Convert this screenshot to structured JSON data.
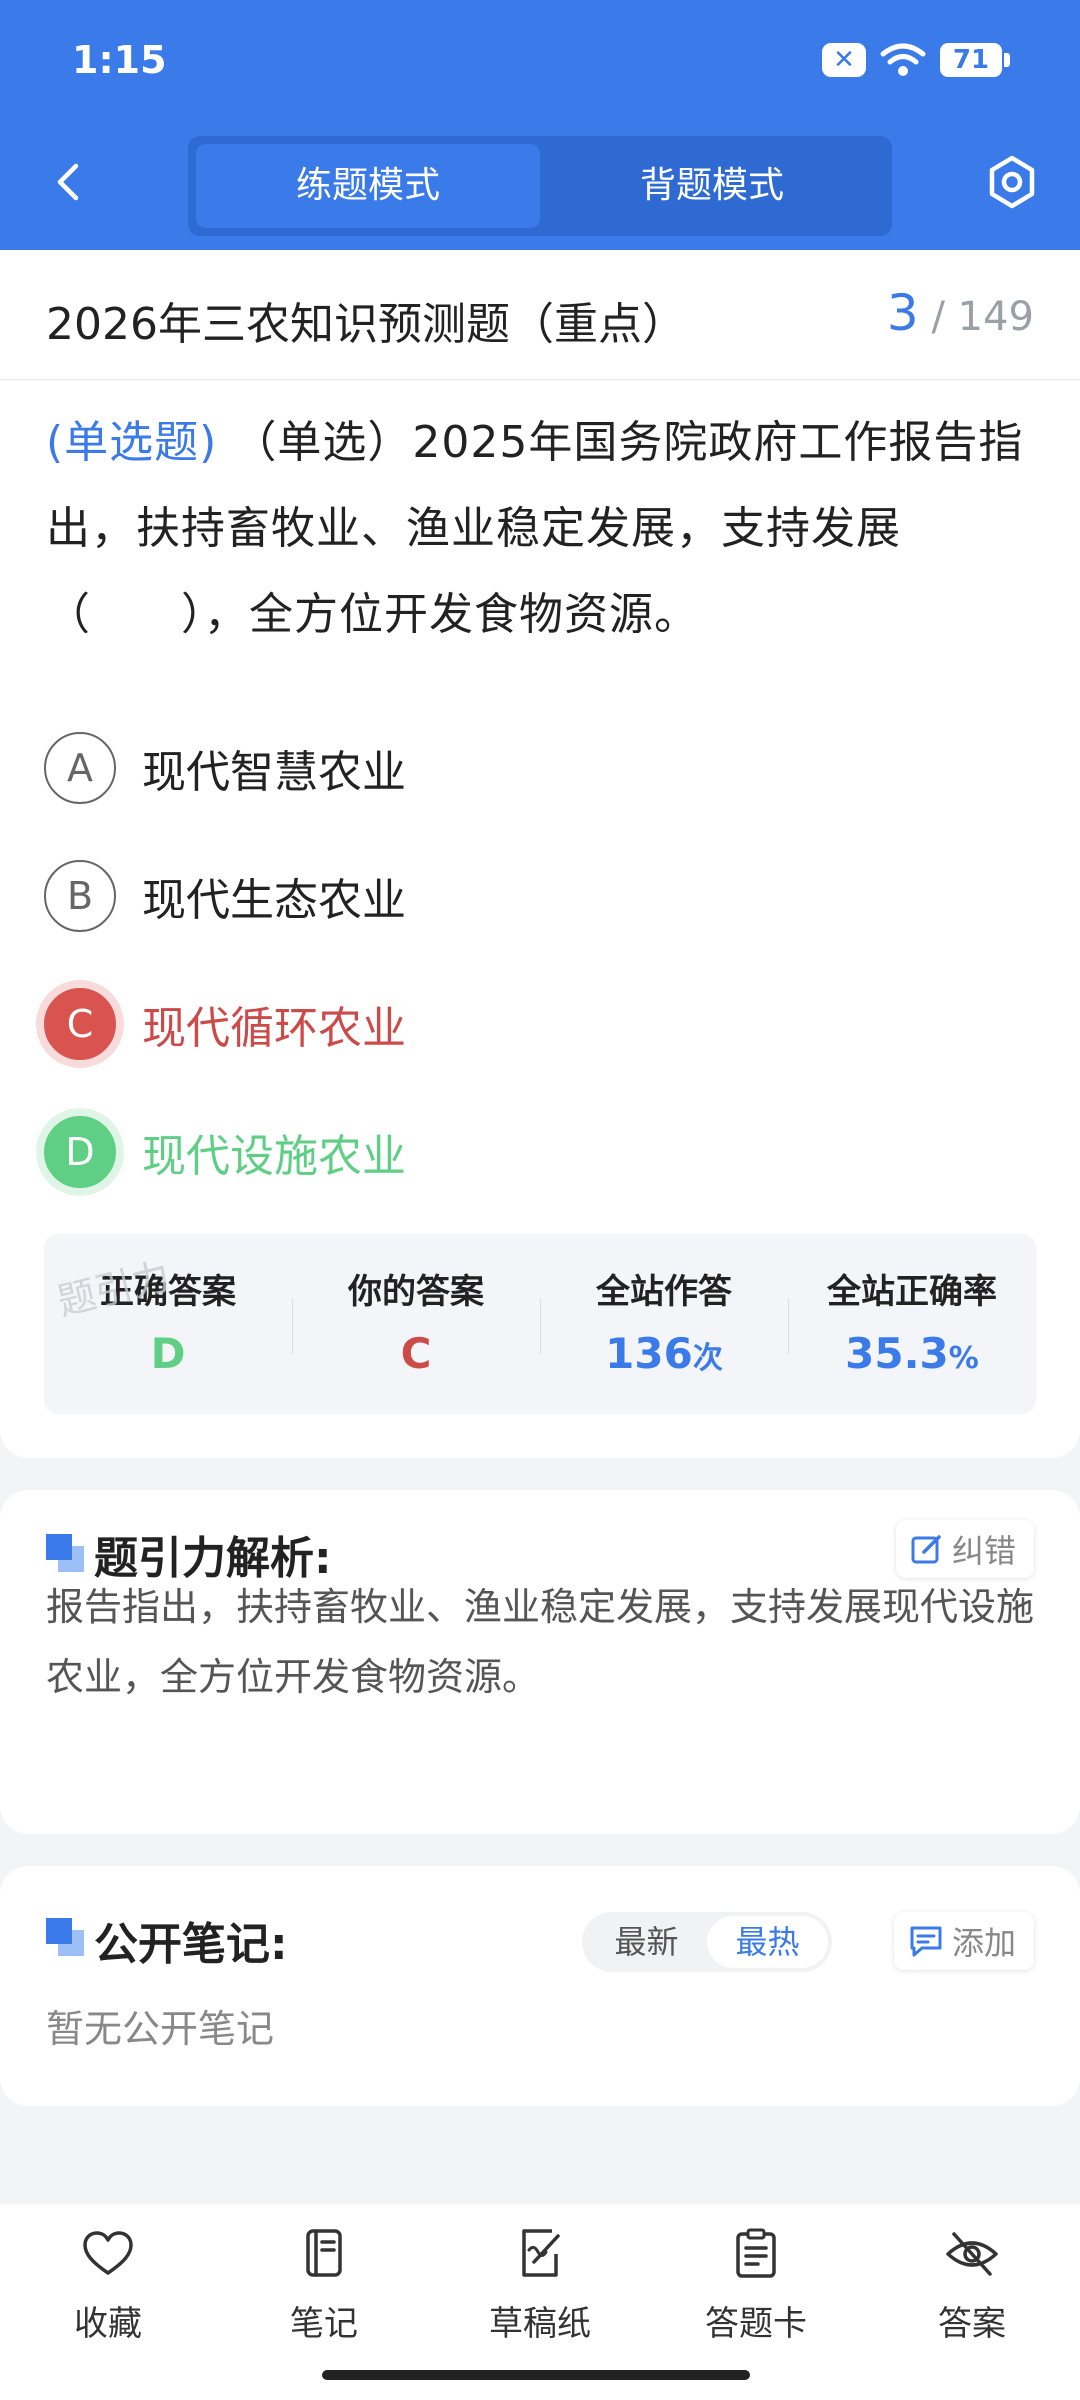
{
  "status_bar": {
    "time": "1:15",
    "battery": "71"
  },
  "header": {
    "tabs": [
      {
        "label": "练题模式",
        "active": true
      },
      {
        "label": "背题模式",
        "active": false
      }
    ]
  },
  "question": {
    "paper_title": "2026年三农知识预测题（重点）",
    "current": "3",
    "total": "/ 149",
    "type_label": "(单选题)",
    "text": "（单选）2025年国务院政府工作报告指出，扶持畜牧业、渔业稳定发展，支持发展（　　），全方位开发食物资源。",
    "options": [
      {
        "letter": "A",
        "text": "现代智慧农业",
        "state": "normal"
      },
      {
        "letter": "B",
        "text": "现代生态农业",
        "state": "normal"
      },
      {
        "letter": "C",
        "text": "现代循环农业",
        "state": "wrong"
      },
      {
        "letter": "D",
        "text": "现代设施农业",
        "state": "right"
      }
    ]
  },
  "stats": {
    "correct_label": "正确答案",
    "correct_value": "D",
    "yours_label": "你的答案",
    "yours_value": "C",
    "total_label": "全站作答",
    "total_value": "136",
    "total_unit": "次",
    "rate_label": "全站正确率",
    "rate_value": "35.3",
    "rate_unit": "%",
    "watermark": "题引力"
  },
  "analysis": {
    "title": "题引力解析:",
    "report_label": "纠错",
    "body": "报告指出，扶持畜牧业、渔业稳定发展，支持发展现代设施农业，全方位开发食物资源。"
  },
  "notes": {
    "title": "公开笔记:",
    "sort_latest": "最新",
    "sort_hot": "最热",
    "add_label": "添加",
    "empty": "暂无公开笔记"
  },
  "bottom_bar": [
    {
      "label": "收藏",
      "icon": "heart-icon"
    },
    {
      "label": "笔记",
      "icon": "notebook-icon"
    },
    {
      "label": "草稿纸",
      "icon": "draft-icon"
    },
    {
      "label": "答题卡",
      "icon": "clipboard-icon"
    },
    {
      "label": "答案",
      "icon": "eye-off-icon"
    }
  ],
  "colors": {
    "brand": "#3b7be9",
    "correct": "#5fcf85",
    "wrong": "#d9534f"
  }
}
